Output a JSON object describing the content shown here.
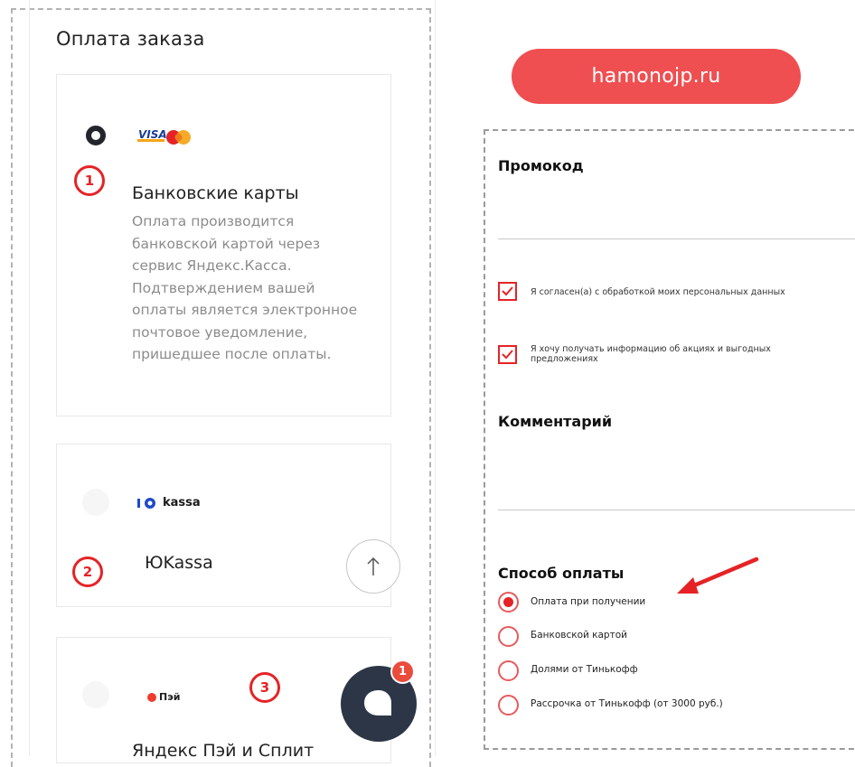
{
  "payment_panel": {
    "title": "Оплата заказа",
    "options": [
      {
        "title": "Банковские карты",
        "description": "Оплата производится банковской картой через сервис Яндекс.Касса. Подтверждением вашей оплаты является электронное почтовое уведомление, пришедшее после оплаты.",
        "selected": true,
        "logo": "visa-mastercard-logo",
        "marker": "1"
      },
      {
        "title": "ЮKassa",
        "logo_text": "kassa",
        "selected": false,
        "marker": "2"
      },
      {
        "title": "Яндекс Пэй и Сплит",
        "logo_text": "Пэй",
        "selected": false,
        "marker": "3"
      }
    ]
  },
  "banner": {
    "text": "hamonojp.ru",
    "color": "#ef4f51"
  },
  "chat": {
    "badge": "1"
  },
  "form": {
    "promo_heading": "Промокод",
    "consents": [
      {
        "label": "Я согласен(а) с обработкой моих персональных данных",
        "checked": true
      },
      {
        "label": "Я хочу получать информацию об акциях и выгодных предложениях",
        "checked": true
      }
    ],
    "comment_heading": "Комментарий",
    "payment_method_heading": "Способ оплаты",
    "payment_methods": [
      {
        "label": "Оплата при получении",
        "selected": true
      },
      {
        "label": "Банковской картой",
        "selected": false
      },
      {
        "label": "Долями от Тинькофф",
        "selected": false
      },
      {
        "label": "Рассрочка от Тинькофф (от 3000 руб.)",
        "selected": false
      }
    ]
  },
  "colors": {
    "accent_red": "#e52326",
    "chat_bg": "#2d3646",
    "muted_text": "#8c8c8c"
  }
}
